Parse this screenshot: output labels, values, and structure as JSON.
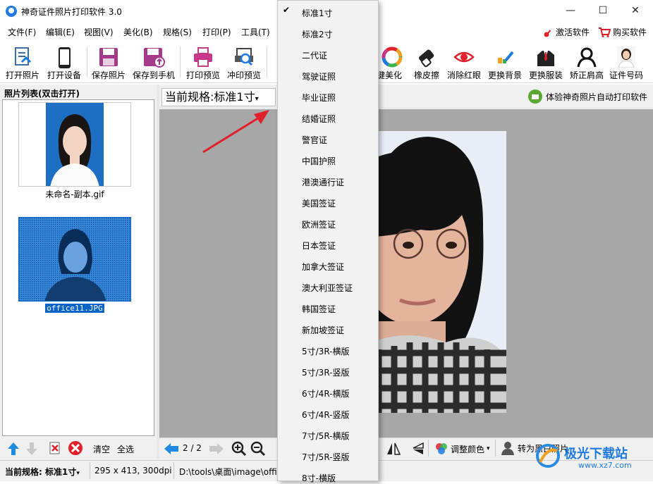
{
  "window": {
    "title": "神奇证件照片打印软件 3.0",
    "min": "—",
    "max": "☐",
    "close": "✕"
  },
  "menubar": [
    "文件(F)",
    "编辑(E)",
    "视图(V)",
    "美化(B)",
    "规格(S)",
    "打印(P)",
    "工具(T)"
  ],
  "menu_right": {
    "activate": "激活软件",
    "buy": "购买软件"
  },
  "toolbar": [
    {
      "label": "打开照片",
      "icon": "open-photo-icon"
    },
    {
      "label": "打开设备",
      "icon": "phone-device-icon"
    },
    {
      "label": "保存照片",
      "icon": "save-icon"
    },
    {
      "label": "保存到手机",
      "icon": "save-to-phone-icon"
    },
    {
      "label": "打印预览",
      "icon": "printer-icon"
    },
    {
      "label": "冲印预览",
      "icon": "print-preview-icon"
    },
    {
      "label": "一键美化",
      "icon": "color-wheel-icon"
    },
    {
      "label": "橡皮擦",
      "icon": "eraser-icon"
    },
    {
      "label": "消除红眼",
      "icon": "eye-icon"
    },
    {
      "label": "更换背景",
      "icon": "background-icon"
    },
    {
      "label": "更换服装",
      "icon": "suit-icon"
    },
    {
      "label": "矫正肩高",
      "icon": "shoulder-icon"
    },
    {
      "label": "证件号码",
      "icon": "id-photo-icon"
    }
  ],
  "left_panel": {
    "header": "照片列表(双击打开)",
    "items": [
      {
        "name": "未命名-副本.gif",
        "selected": false
      },
      {
        "name": "office11.JPG",
        "selected": true
      }
    ],
    "clear": "清空",
    "select_all": "全选"
  },
  "right": {
    "spec_label": "当前规格:",
    "spec_value": "标准1寸",
    "auto_print": "体验神奇照片自动打印软件",
    "page": "2 / 2",
    "adjust_color": "调整颜色",
    "to_bw": "转为黑白照片"
  },
  "dropdown": {
    "checked": "标准1寸",
    "items": [
      "标准1寸",
      "标准2寸",
      "二代证",
      "驾驶证照",
      "毕业证照",
      "结婚证照",
      "警官证",
      "中国护照",
      "港澳通行证",
      "美国签证",
      "欧洲签证",
      "日本签证",
      "加拿大签证",
      "澳大利亚签证",
      "韩国签证",
      "新加坡签证",
      "5寸/3R-横版",
      "5寸/3R-竖版",
      "6寸/4R-横版",
      "6寸/4R-竖版",
      "7寸/5R-横版",
      "7寸/5R-竖版",
      "8寸-横版"
    ]
  },
  "status": {
    "spec_label": "当前规格:",
    "spec_value": "标准1寸",
    "size": "295 x 413, 300dpi",
    "path": "D:\\tools\\桌面\\image\\offi"
  },
  "watermark": {
    "text": "极光下载站",
    "url": "www.xz7.com"
  },
  "colors": {
    "accent": "#1f7ae0",
    "red": "#e0202a",
    "selection": "#0a64c8"
  }
}
